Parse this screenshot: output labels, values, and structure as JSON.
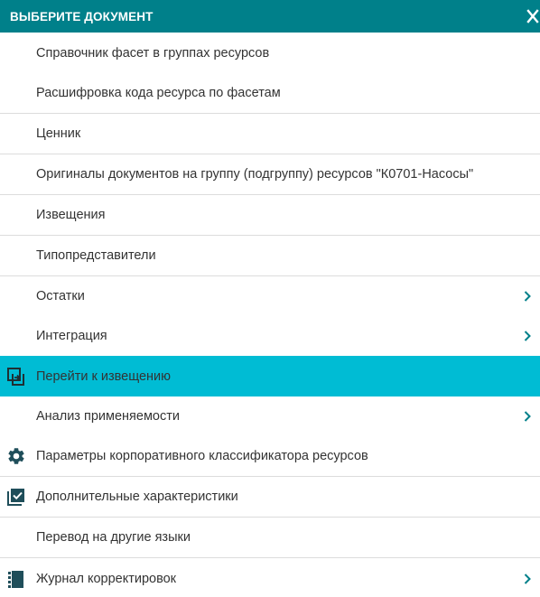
{
  "header": {
    "title": "ВЫБЕРИТЕ ДОКУМЕНТ"
  },
  "menu": {
    "items": [
      {
        "label": "Справочник фасет в группах ресурсов"
      },
      {
        "label": "Расшифровка кода ресурса по фасетам"
      },
      {
        "label": "Ценник"
      },
      {
        "label": "Оригиналы документов на группу (подгруппу) ресурсов \"К0701-Насосы\""
      },
      {
        "label": "Извещения"
      },
      {
        "label": "Типопредставители"
      },
      {
        "label": "Остатки",
        "submenu": true
      },
      {
        "label": "Интеграция",
        "submenu": true
      },
      {
        "label": "Перейти к извещению",
        "icon": "go-to-document-icon",
        "active": true
      },
      {
        "label": "Анализ применяемости",
        "submenu": true
      },
      {
        "label": "Параметры корпоративного классификатора ресурсов",
        "icon": "gear-icon"
      },
      {
        "label": "Дополнительные характеристики",
        "icon": "checked-list-icon"
      },
      {
        "label": "Перевод на другие языки"
      },
      {
        "label": "Журнал корректировок",
        "icon": "journal-icon",
        "submenu": true
      }
    ]
  },
  "colors": {
    "header_bg": "#00808a",
    "active_bg": "#00bcd4",
    "icon_dark": "#1f4e5a",
    "chevron": "#00808a"
  }
}
